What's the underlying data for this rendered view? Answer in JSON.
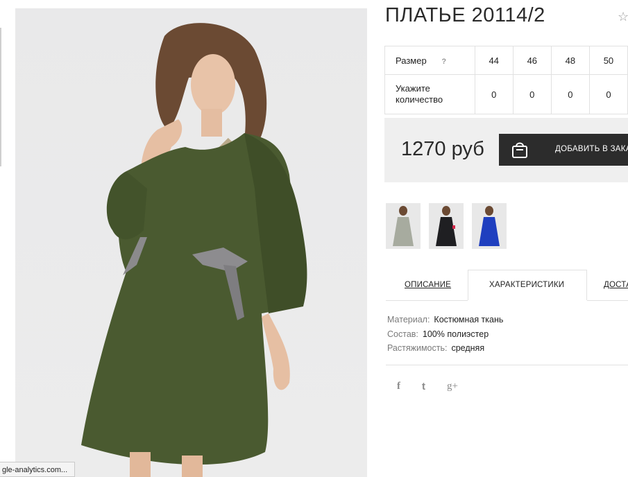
{
  "product": {
    "title": "ПЛАТЬЕ 20114/2",
    "favorite_icon": "star-icon"
  },
  "size_table": {
    "size_label": "Размер",
    "help_mark": "?",
    "sizes": [
      "44",
      "46",
      "48",
      "50"
    ],
    "quantity_label_line1": "Укажите",
    "quantity_label_line2": "количество",
    "quantities": [
      "0",
      "0",
      "0",
      "0"
    ]
  },
  "purchase": {
    "price": "1270 руб",
    "add_button_label": "ДОБАВИТЬ В ЗАКАЗ",
    "bag_icon": "shopping-bag-icon"
  },
  "thumbnails": [
    {
      "name": "olive dress",
      "dress_color": "#a7ab9f"
    },
    {
      "name": "black dress",
      "dress_color": "#1f1f22"
    },
    {
      "name": "blue dress",
      "dress_color": "#1f3fbf"
    }
  ],
  "tabs": [
    {
      "label": "ОПИСАНИЕ"
    },
    {
      "label": "ХАРАКТЕРИСТИКИ",
      "active": true
    },
    {
      "label": "ДОСТАВКА"
    }
  ],
  "specs": [
    {
      "key": "Материал:",
      "value": "Костюмная ткань"
    },
    {
      "key": "Состав:",
      "value": "100% полиэстер"
    },
    {
      "key": "Растяжимость:",
      "value": "средняя"
    }
  ],
  "social": {
    "facebook": "f",
    "twitter": "t",
    "google_plus": "g+"
  },
  "status_bar": {
    "text": "gle-analytics.com..."
  },
  "colors": {
    "dress_main": "#4a5a30",
    "price_box_bg": "#efefef",
    "button_bg": "#2c2c2c"
  }
}
